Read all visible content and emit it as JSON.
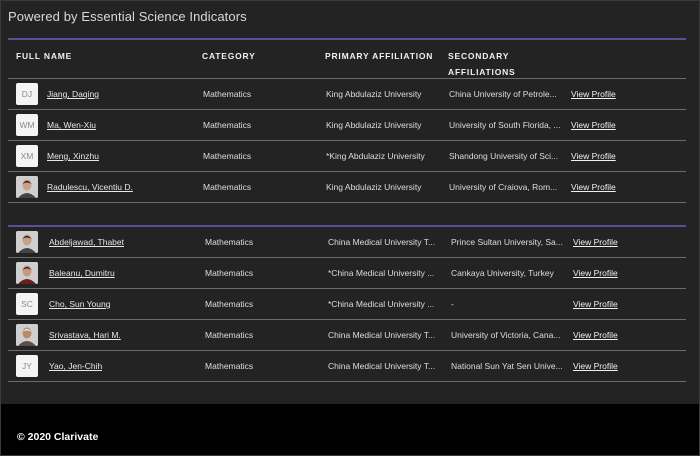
{
  "powered_by": "Powered by Essential Science Indicators",
  "columns": {
    "full_name": "FULL NAME",
    "category": "CATEGORY",
    "primary": "PRIMARY AFFILIATION",
    "secondary_1": "SECONDARY",
    "secondary_2": "AFFILIATIONS"
  },
  "table1": [
    {
      "initials": "DJ",
      "name": "Jiang, Daqing",
      "category": "Mathematics",
      "primary": "King Abdulaziz University",
      "secondary": "China University of Petrole...",
      "action": "View Profile"
    },
    {
      "initials": "WM",
      "name": "Ma, Wen-Xiu",
      "category": "Mathematics",
      "primary": "King Abdulaziz University",
      "secondary": "University of South Florida, ...",
      "action": "View Profile"
    },
    {
      "initials": "XM",
      "name": "Meng, Xinzhu",
      "category": "Mathematics",
      "primary": "*King Abdulaziz University",
      "secondary": "Shandong University of Sci...",
      "action": "View Profile"
    },
    {
      "initials": "",
      "name": "Radulescu, Vicentiu D.",
      "category": "Mathematics",
      "primary": "King Abdulaziz University",
      "secondary": "University of Craiova, Rom...",
      "action": "View Profile"
    }
  ],
  "table2": [
    {
      "initials": "",
      "name": "Abdeljawad, Thabet",
      "category": "Mathematics",
      "primary": "China Medical University T...",
      "secondary": "Prince Sultan University, Sa...",
      "action": "View Profile"
    },
    {
      "initials": "",
      "name": "Baleanu, Dumitru",
      "category": "Mathematics",
      "primary": "*China Medical University ...",
      "secondary": "Cankaya University, Turkey",
      "action": "View Profile"
    },
    {
      "initials": "SC",
      "name": "Cho, Sun Young",
      "category": "Mathematics",
      "primary": "*China Medical University ...",
      "secondary": "-",
      "action": "View Profile"
    },
    {
      "initials": "",
      "name": "Srivastava, Hari M.",
      "category": "Mathematics",
      "primary": "China Medical University T...",
      "secondary": "University of Victoria, Cana...",
      "action": "View Profile"
    },
    {
      "initials": "JY",
      "name": "Yao, Jen-Chih",
      "category": "Mathematics",
      "primary": "China Medical University T...",
      "secondary": "National Sun Yat Sen Unive...",
      "action": "View Profile"
    }
  ],
  "footer": "© 2020 Clarivate"
}
